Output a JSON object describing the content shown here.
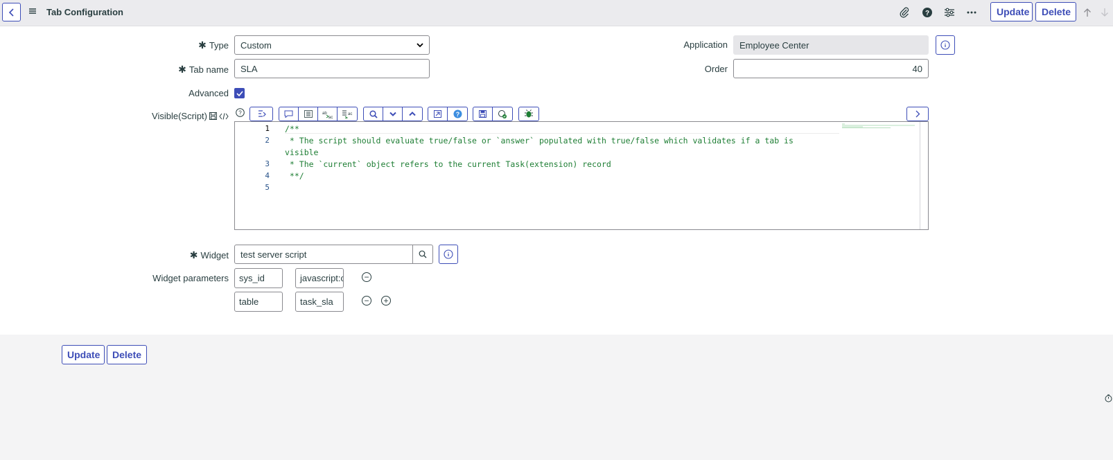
{
  "header": {
    "title": "Tab Configuration",
    "update_label": "Update",
    "delete_label": "Delete"
  },
  "form": {
    "type": {
      "label": "Type",
      "value": "Custom"
    },
    "tab_name": {
      "label": "Tab name",
      "value": "SLA"
    },
    "advanced": {
      "label": "Advanced",
      "checked": true
    },
    "application": {
      "label": "Application",
      "value": "Employee Center"
    },
    "order": {
      "label": "Order",
      "value": "40"
    },
    "visible_script": {
      "label": "Visible(Script)",
      "lines": [
        {
          "num": "1",
          "text": "/**"
        },
        {
          "num": "2",
          "text": " * The script should evaluate true/false or `answer` populated with true/false which validates if a tab is"
        },
        {
          "num": "",
          "text": "visible"
        },
        {
          "num": "3",
          "text": " * The `current` object refers to the current Task(extension) record"
        },
        {
          "num": "4",
          "text": " **/"
        },
        {
          "num": "5",
          "text": ""
        }
      ]
    },
    "widget": {
      "label": "Widget",
      "value": "test server script"
    },
    "widget_parameters": {
      "label": "Widget parameters",
      "rows": [
        {
          "key": "sys_id",
          "value": "javascript:c"
        },
        {
          "key": "table",
          "value": "task_sla"
        }
      ]
    }
  },
  "footer": {
    "update_label": "Update",
    "delete_label": "Delete"
  },
  "colors": {
    "accent": "#3d4db7",
    "code_comment": "#1e7e34",
    "topbar_bg": "#ebebee"
  }
}
